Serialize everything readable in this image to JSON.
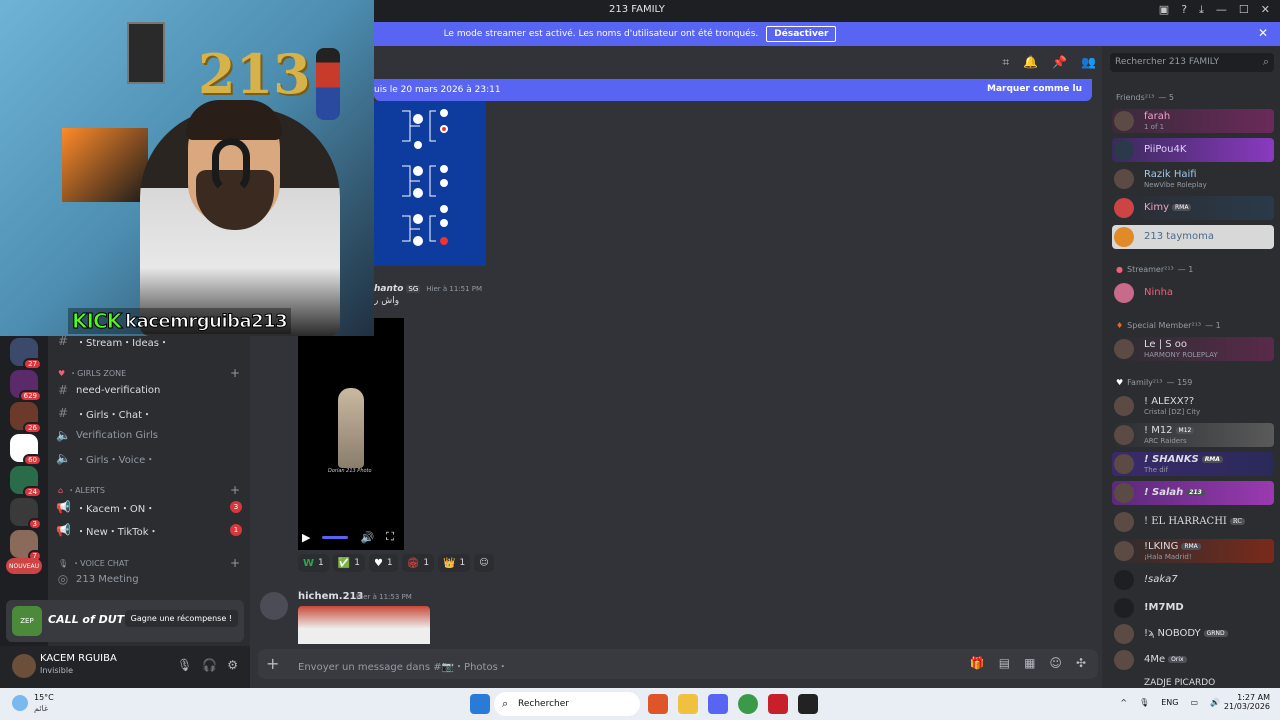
{
  "window": {
    "title": "213 FAMILY",
    "controls": [
      "notifications-icon",
      "help-icon",
      "download-icon",
      "minimize-icon",
      "maximize-icon",
      "close-icon"
    ]
  },
  "banner": {
    "text": "Le mode streamer est activé. Les noms d'utilisateur ont été tronqués.",
    "button": "Désactiver"
  },
  "servers": [
    {
      "badge": "27",
      "color": "#3b4a6b"
    },
    {
      "badge": "629",
      "color": "#5a2a6b"
    },
    {
      "badge": "26",
      "color": "#6b3a2a"
    },
    {
      "badge": "60",
      "color": "#d33"
    },
    {
      "badge": "24",
      "color": "#2a6b4a"
    },
    {
      "badge": "3",
      "color": "#3a3a3a"
    },
    {
      "badge": "7",
      "color": "#8a6a5a"
    },
    {
      "badge": "NOUVEAU",
      "color": "#c44"
    }
  ],
  "channels": {
    "stream_ideas": "・Stream・Ideas・",
    "girls_zone": "・GIRLS ZONE",
    "need_verification": "need-verification",
    "girls_chat": "・Girls・Chat・",
    "verification_girls": "Verification Girls",
    "girls_voice": "・Girls・Voice・",
    "alerts": "・ALERTS",
    "kacem_on": "・Kacem・ON・",
    "kacem_on_badge": "3",
    "new_tiktok": "・New・TikTok・",
    "new_tiktok_badge": "1",
    "voice_chat": "・VOICE CHAT",
    "meeting": "213 Meeting"
  },
  "promo": {
    "logo": "ZEP",
    "game": "CALL of DUTY",
    "cta": "Gagne une récompense !"
  },
  "user": {
    "name": "KACEM RGUIBA",
    "status": "Invisible"
  },
  "new_messages": {
    "since": "uis le 20 mars 2026 à 23:11",
    "mark": "Marquer comme lu"
  },
  "message1": {
    "author": "hanto",
    "tag": "SG",
    "time": "Hier à 11:51 PM",
    "text": "واش ر"
  },
  "video": {
    "watermark": "Dorian 213 Photo"
  },
  "reactions": [
    {
      "emoji": "W",
      "count": "1",
      "color": "#2aa84a"
    },
    {
      "emoji": "✅",
      "count": "1",
      "color": "#2aa84a"
    },
    {
      "emoji": "♥",
      "count": "1",
      "color": "#fff"
    },
    {
      "emoji": "🏟",
      "count": "1",
      "color": "#c44"
    },
    {
      "emoji": "👑",
      "count": "1",
      "color": "#e0b020"
    }
  ],
  "message2": {
    "author": "hichem.213",
    "time": "Hier à 11:53 PM"
  },
  "composer": {
    "placeholder": "Envoyer un message dans #📷・Photos・"
  },
  "search": {
    "placeholder": "Rechercher 213 FAMILY"
  },
  "groups": [
    {
      "name": "Friends²¹³",
      "count": "— 5"
    },
    {
      "name": "Streamer²¹³",
      "count": "— 1"
    },
    {
      "name": "Special Member²¹³",
      "count": "— 1"
    },
    {
      "name": "Family²¹³",
      "count": "— 159"
    }
  ],
  "members": [
    {
      "name": "farah",
      "sub": "1 of 1",
      "color": "#f0a0c8",
      "bg": "#5a2a4a"
    },
    {
      "name": "PiiPou4K",
      "sub": "",
      "color": "#e0d0ff",
      "bg": "#7a3ab0"
    },
    {
      "name": "Razik Haifi",
      "sub": "NewVibe Roleplay",
      "color": "#9ec9f0",
      "bg": ""
    },
    {
      "name": "Kimy",
      "sub": "",
      "color": "#f0a0c8",
      "bg": "#3a2a4a",
      "pill": "RMA"
    },
    {
      "name": "213 taymoma",
      "sub": "",
      "color": "#4a6a8a",
      "bg": "#d8d8d8"
    },
    {
      "name": "Ninha",
      "sub": "",
      "color": "#f0607a",
      "bg": ""
    },
    {
      "name": "Le | S oo",
      "sub": "HARMONY ROLEPLAY",
      "color": "#fff",
      "bg": "#4a2a3a"
    },
    {
      "name": "! ALEXX??",
      "sub": "Cristal [DZ] City",
      "color": "#fff",
      "bg": ""
    },
    {
      "name": "! M12",
      "sub": "ARC Raiders",
      "color": "#fff",
      "bg": "#4a4a4a",
      "pill": "M12"
    },
    {
      "name": "! SHANKS",
      "sub": "The dif",
      "color": "#fff",
      "bg": "#3a2a6a",
      "pill": "RMA"
    },
    {
      "name": "! Salah",
      "sub": "",
      "color": "#fff",
      "bg": "#6a2a8a",
      "pill": "213"
    },
    {
      "name": "! EL HARRACHI",
      "sub": "",
      "color": "#fff",
      "bg": "",
      "pill": "RC"
    },
    {
      "name": "!LKING",
      "sub": "¡Hala Madrid!",
      "color": "#fff",
      "bg": "#6a2a1a",
      "pill": "RMA"
    },
    {
      "name": "!saka7",
      "sub": "",
      "color": "#fff",
      "bg": ""
    },
    {
      "name": "!M7MD",
      "sub": "",
      "color": "#fff",
      "bg": ""
    },
    {
      "name": "!ϡ NOBODY",
      "sub": "",
      "color": "#fff",
      "bg": "",
      "pill": "GRND"
    },
    {
      "name": "4Me",
      "sub": "",
      "color": "#fff",
      "bg": "",
      "pill": "Orix"
    },
    {
      "name": "ZADJE PICARDO",
      "sub": "",
      "color": "#fff",
      "bg": ""
    }
  ],
  "stream": {
    "brand": "KICK",
    "username": "kacemrguiba213",
    "number": "213"
  },
  "taskbar": {
    "temp": "15°C",
    "weather_sub": "غائم",
    "search": "Rechercher",
    "lang": "ENG",
    "time": "1:27 AM",
    "date": "21/03/2026"
  }
}
